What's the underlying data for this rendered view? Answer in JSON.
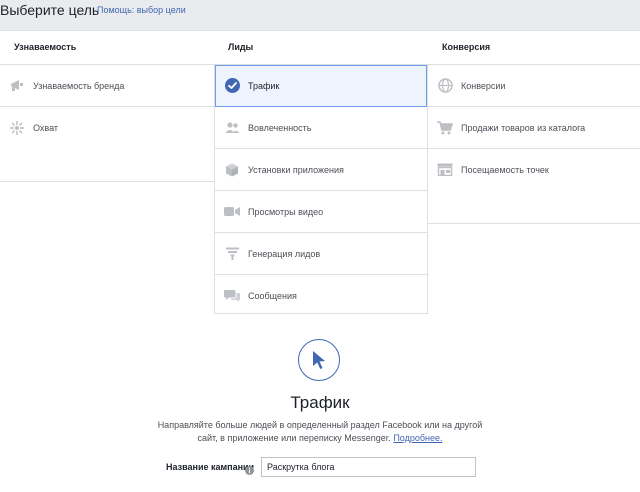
{
  "header": {
    "title": "Выберите цель",
    "help_link": "Помощь: выбор цели"
  },
  "columns": {
    "awareness": {
      "title": "Узнаваемость",
      "items": [
        {
          "label": "Узнаваемость бренда",
          "icon": "megaphone-icon"
        },
        {
          "label": "Охват",
          "icon": "reach-icon"
        }
      ]
    },
    "consideration": {
      "title": "Лиды",
      "items": [
        {
          "label": "Трафик",
          "icon": "check-circle-icon",
          "selected": true
        },
        {
          "label": "Вовлеченность",
          "icon": "people-icon"
        },
        {
          "label": "Установки приложения",
          "icon": "cube-icon"
        },
        {
          "label": "Просмотры видео",
          "icon": "video-camera-icon"
        },
        {
          "label": "Генерация лидов",
          "icon": "filter-funnel-icon"
        },
        {
          "label": "Сообщения",
          "icon": "chat-bubbles-icon"
        }
      ]
    },
    "conversion": {
      "title": "Конверсия",
      "items": [
        {
          "label": "Конверсии",
          "icon": "globe-icon"
        },
        {
          "label": "Продажи товаров из каталога",
          "icon": "shopping-cart-icon"
        },
        {
          "label": "Посещаемость точек",
          "icon": "store-icon"
        }
      ]
    }
  },
  "detail": {
    "icon": "cursor-arrow-icon",
    "title": "Трафик",
    "description": "Направляйте больше людей в определенный раздел Facebook или на другой сайт, в приложение или переписку Messenger.",
    "more_link": "Подробнее.",
    "campaign_name_label": "Название кампании",
    "campaign_name_value": "Раскрутка блога"
  },
  "colors": {
    "accent": "#4267b2",
    "selected_bg": "#eef4fd",
    "selected_border": "#6d9cf0",
    "icon_gray": "#bcc0c4",
    "page_bg": "#e9ebee"
  }
}
